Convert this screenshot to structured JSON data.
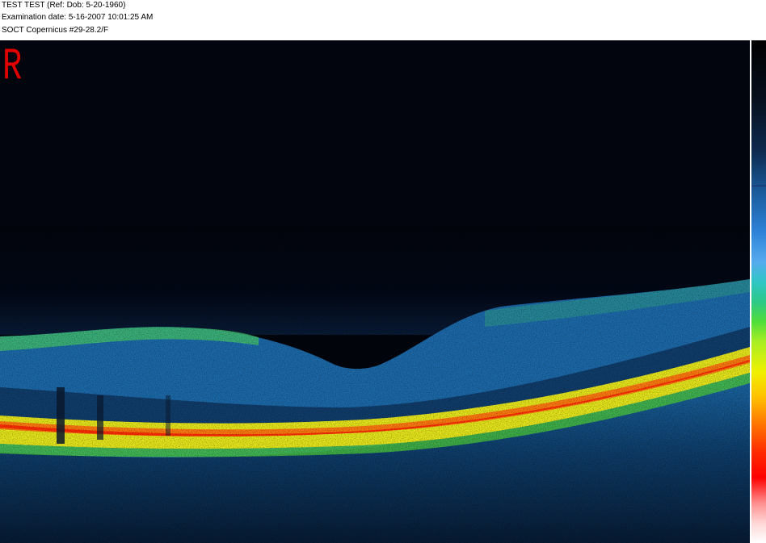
{
  "header": {
    "patient_line": "TEST TEST  (Ref:  Dob: 5-20-1960)",
    "exam_line": "Examination date: 5-16-2007  10:01:25 AM",
    "device_line": "SOCT Copernicus #29-28.2/F"
  },
  "scan": {
    "eye_label": "R",
    "colors": {
      "background": "#02050d",
      "eye_label": "#e00000"
    }
  },
  "colorbar": {
    "orientation": "vertical",
    "low_to_high": [
      "#000000",
      "#1a5a9a",
      "#2d82d8",
      "#2cc888",
      "#f0f000",
      "#ff7a00",
      "#ff0000",
      "#ffffff"
    ]
  }
}
